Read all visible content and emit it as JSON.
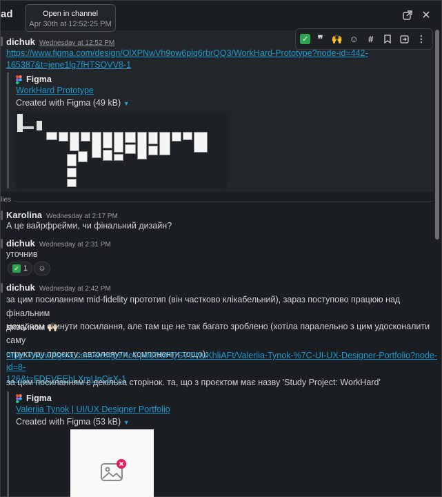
{
  "header": {
    "title": "ad"
  },
  "tooltip": {
    "title": "Open in channel",
    "time": "Apr 30th at 12:52:25 PM"
  },
  "actions": {
    "icons": [
      "check-emoji",
      "eyes-emoji",
      "raised-hands-emoji",
      "add-reaction",
      "reply-in-channel",
      "bookmark",
      "forward",
      "more"
    ]
  },
  "parent": {
    "author": "dichuk",
    "time": "Wednesday at 12:52 PM",
    "link_line1": "https://www.figma.com/design/OlXPNwVh9ow6plq6rbrQQ3/WorkHard-Prototype?node-id=442-",
    "link_line2": "165387&t=jene1lg7fHTSOVV8-1",
    "attachment": {
      "source": "Figma",
      "title": "WorkHard Prototype",
      "meta": "Created with Figma (49 kB)"
    }
  },
  "replies_label": "lies",
  "messages": [
    {
      "author": "Karolina",
      "time": "Wednesday at 2:17 PM",
      "text": "А це вайрфрейми, чи фінальний дизайн?"
    },
    {
      "author": "dichuk",
      "time": "Wednesday at 2:31 PM",
      "text": "уточнив",
      "reaction_count": "1"
    },
    {
      "author": "dichuk",
      "time": "Wednesday at 2:42 PM",
      "p1a": "за цим посиланням mid-fidelity прототип (він частково клікабельний), зараз поступово працюю над фінальним",
      "p1b": "дизайном 🙌🏻",
      "p2a": "можу вам скинути посилання, але там ще не так багато зроблено (хотіла паралельно з цим удосконалити саму",
      "p2b": "структуру проєкту: автолеяути, компоненти тощо):",
      "link_a": "https://www.figma.com/design/XoCpbdGbFQSVONuKhliAFt/Valeriia-Tynok-%7C-UI-UX-Designer-Portfolio?node-id=8-",
      "link_b": "126&t=FDEVEEhLXmUnCjrX-1",
      "p3": "за цим посиланням є декілька сторінок. та, що з проєктом має назву 'Study Project: WorkHard'",
      "attachment": {
        "source": "Figma",
        "title": "Valeriia Tynok | UI/UX Designer Portfolio",
        "meta": "Created with Figma (53 kB)"
      }
    }
  ],
  "colors": {
    "background": "#1a1d21",
    "link": "#1d9bd1",
    "check": "#2fa44f"
  }
}
